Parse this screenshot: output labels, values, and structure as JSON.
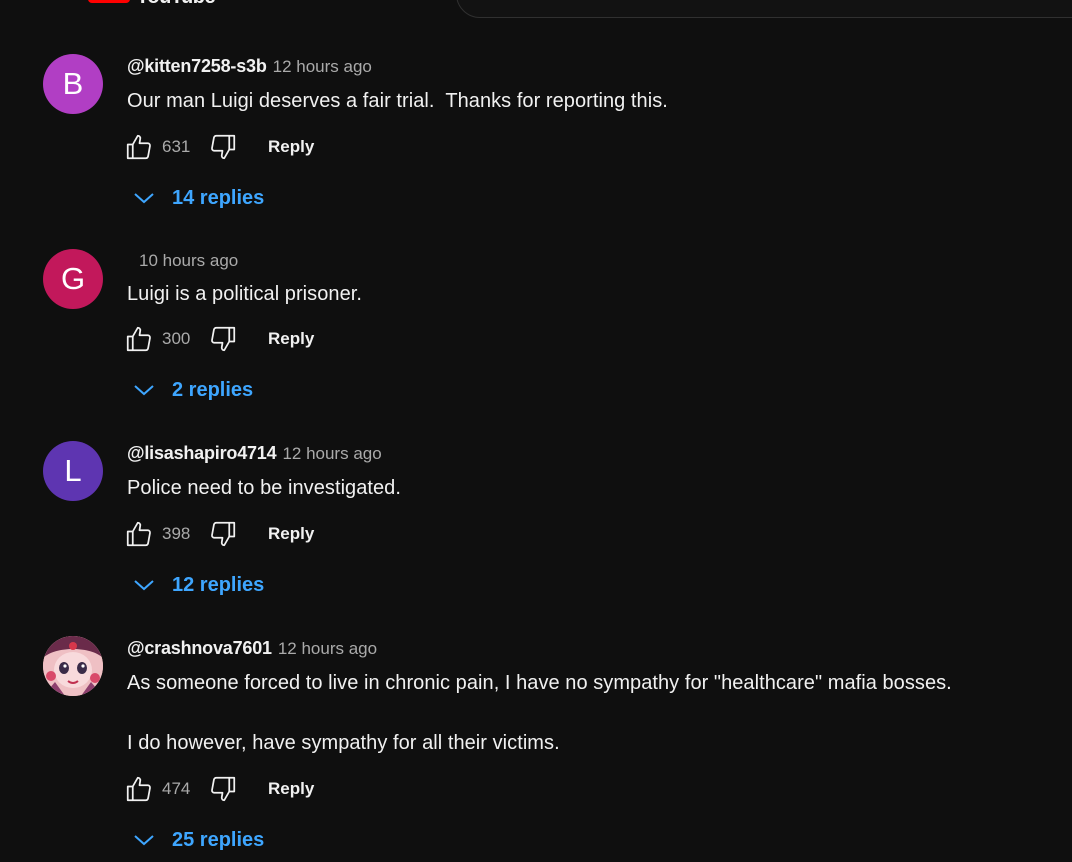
{
  "header": {
    "logo_text": "YouTube"
  },
  "comments": [
    {
      "avatar_letter": "B",
      "avatar_color": "#b13ec4",
      "author": "@kitten7258-s3b",
      "time": "12 hours ago",
      "text_lines": [
        "Our man Luigi deserves a fair trial.  Thanks for reporting this."
      ],
      "likes": "631",
      "reply_label": "Reply",
      "replies_label": "14 replies"
    },
    {
      "avatar_letter": "G",
      "avatar_color": "#c2185b",
      "author": "",
      "time": "10 hours ago",
      "text_lines": [
        "Luigi is a political prisoner."
      ],
      "likes": "300",
      "reply_label": "Reply",
      "replies_label": "2 replies"
    },
    {
      "avatar_letter": "L",
      "avatar_color": "#5e35b1",
      "author": "@lisashapiro4714",
      "time": "12 hours ago",
      "text_lines": [
        "Police need to be investigated."
      ],
      "likes": "398",
      "reply_label": "Reply",
      "replies_label": "12 replies"
    },
    {
      "avatar_letter": "",
      "avatar_color": "#e6a9b0",
      "author": "@crashnova7601",
      "time": "12 hours ago",
      "text_lines": [
        "As someone forced to live in chronic pain, I have no sympathy for \"healthcare\" mafia bosses.",
        "I do however, have sympathy for all their victims."
      ],
      "likes": "474",
      "reply_label": "Reply",
      "replies_label": "25 replies"
    }
  ]
}
